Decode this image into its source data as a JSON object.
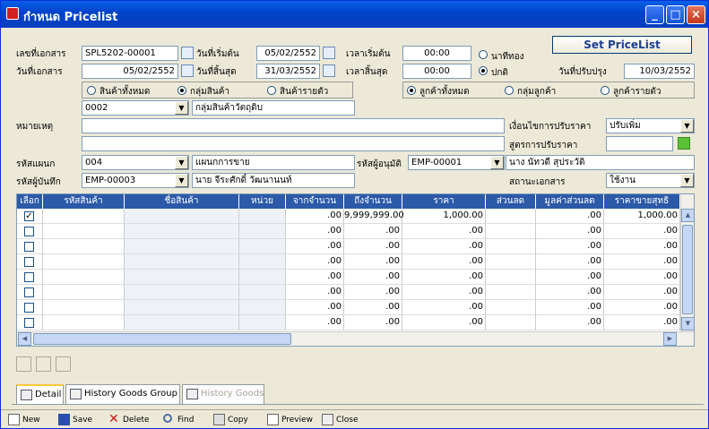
{
  "window": {
    "title": "กำหนด Pricelist"
  },
  "header": {
    "doc_no_label": "เลขที่เอกสาร",
    "doc_no": "SPL5202-00001",
    "doc_date_label": "วันที่เอกสาร",
    "doc_date": "05/02/2552",
    "start_date_label": "วันที่เริ่มต้น",
    "start_date": "05/02/2552",
    "end_date_label": "วันที่สิ้นสุด",
    "end_date": "31/03/2552",
    "start_time_label": "เวลาเริ่มต้น",
    "start_time": "00:00",
    "end_time_label": "เวลาสิ้นสุด",
    "end_time": "00:00",
    "radio_always": "นาทีทอง",
    "radio_normal": "ปกติ",
    "update_date_label": "วันที่ปรับปรุง",
    "update_date": "10/03/2552",
    "set_pricelist_button": "Set PriceList"
  },
  "product_scope": {
    "all": "สินค้าทั้งหมด",
    "group": "กลุ่มสินค้า",
    "item": "สินค้ารายตัว",
    "group_code": "0002",
    "group_name": "กลุ่มสินค้าวัตถุดิบ"
  },
  "customer_scope": {
    "all": "ลูกค้าทั้งหมด",
    "group": "กลุ่มลูกค้า",
    "item": "ลูกค้ารายตัว"
  },
  "notes": {
    "label": "หมายเหตุ",
    "value": ""
  },
  "condition": {
    "label": "เงื่อนไขการปรับราคา",
    "value": "ปรับเพิ่ม",
    "formula_label": "สูตรการปรับราคา",
    "formula_value": ""
  },
  "department": {
    "label": "รหัสแผนก",
    "code": "004",
    "name": "แผนกการขาย"
  },
  "approver": {
    "label": "รหัสผู้อนุมัติ",
    "code": "EMP-00001",
    "name": "นาง นัทวดี สุประวัติ"
  },
  "recorder": {
    "label": "รหัสผู้บันทึก",
    "code": "EMP-00003",
    "name": "นาย จีระศักดิ์ วัฒนานนท์"
  },
  "doc_status": {
    "label": "สถานะเอกสาร",
    "value": "ใช้งาน"
  },
  "grid": {
    "columns": [
      "เลือก",
      "รหัสสินค้า",
      "ชื่อสินค้า",
      "หน่วย",
      "จากจำนวน",
      "ถึงจำนวน",
      "ราคา",
      "ส่วนลด",
      "มูลค่าส่วนลด",
      "ราคาขายสุทธิ"
    ],
    "rows": [
      {
        "checked": "✓",
        "from": ".00",
        "to": "9,999,999.00",
        "price": "1,000.00",
        "disc_val": ".00",
        "net": "1,000.00"
      },
      {
        "checked": "",
        "from": ".00",
        "to": ".00",
        "price": ".00",
        "disc_val": ".00",
        "net": ".00"
      },
      {
        "checked": "",
        "from": ".00",
        "to": ".00",
        "price": ".00",
        "disc_val": ".00",
        "net": ".00"
      },
      {
        "checked": "",
        "from": ".00",
        "to": ".00",
        "price": ".00",
        "disc_val": ".00",
        "net": ".00"
      },
      {
        "checked": "",
        "from": ".00",
        "to": ".00",
        "price": ".00",
        "disc_val": ".00",
        "net": ".00"
      },
      {
        "checked": "",
        "from": ".00",
        "to": ".00",
        "price": ".00",
        "disc_val": ".00",
        "net": ".00"
      },
      {
        "checked": "",
        "from": ".00",
        "to": ".00",
        "price": ".00",
        "disc_val": ".00",
        "net": ".00"
      },
      {
        "checked": "",
        "from": ".00",
        "to": ".00",
        "price": ".00",
        "disc_val": ".00",
        "net": ".00"
      }
    ]
  },
  "tabs": [
    {
      "label": "Detail"
    },
    {
      "label": "History Goods Group"
    },
    {
      "label": "History Goods"
    }
  ],
  "toolbar": {
    "new": "New",
    "save": "Save",
    "delete": "Delete",
    "find": "Find",
    "copy": "Copy",
    "preview": "Preview",
    "close": "Close"
  }
}
